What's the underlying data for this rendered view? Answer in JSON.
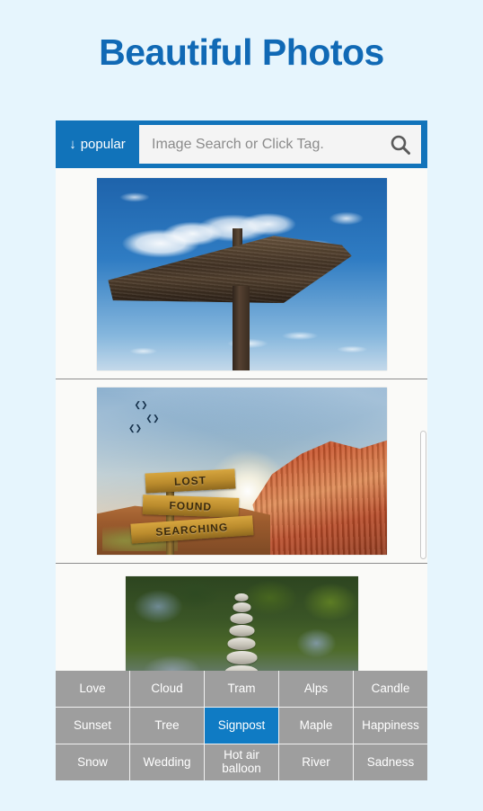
{
  "page": {
    "title": "Beautiful Photos",
    "background_color": "#e6f5fd",
    "title_color": "#1069b5"
  },
  "search": {
    "sort_label": "popular",
    "sort_icon": "arrow-down-icon",
    "placeholder": "Image Search or Click Tag.",
    "value": "",
    "search_icon": "magnifier-icon",
    "bar_color": "#1173ba"
  },
  "photos": [
    {
      "id": "photo-1",
      "alt": "Wooden arrow signpost against blue sky with white clouds",
      "signs": []
    },
    {
      "id": "photo-2",
      "alt": "Desert canyon signpost at sunrise with red rock formation",
      "signs": [
        "LOST",
        "FOUND",
        "SEARCHING"
      ]
    },
    {
      "id": "photo-3",
      "alt": "Stacked stone cairn in front of green foliage",
      "signs": []
    }
  ],
  "tags": {
    "selected": "Signpost",
    "selected_color": "#0f7bc4",
    "cell_color": "#9e9e9e",
    "items": [
      "Love",
      "Cloud",
      "Tram",
      "Alps",
      "Candle",
      "Sunset",
      "Tree",
      "Signpost",
      "Maple",
      "Happiness",
      "Snow",
      "Wedding",
      "Hot air balloon",
      "River",
      "Sadness"
    ]
  }
}
